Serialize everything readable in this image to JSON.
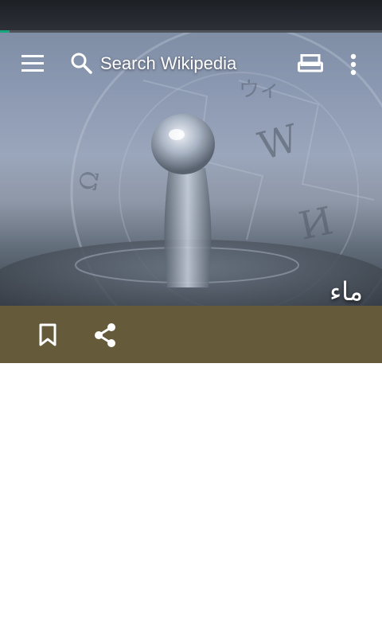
{
  "status_bar": {},
  "page_load_progress": 0.025,
  "toolbar": {
    "menu_icon": "hamburger-menu-icon",
    "search_icon": "search-icon",
    "search_placeholder": "Search Wikipedia",
    "tabs_icon": "tabs-icon",
    "more_icon": "more-vert-icon"
  },
  "lead": {
    "title": "ماء",
    "image_description_icon": "water-droplet-image"
  },
  "action_bar": {
    "bookmark_icon": "bookmark-icon",
    "share_icon": "share-icon",
    "background_color": "#655a39"
  },
  "colors": {
    "accent": "#17a57f",
    "status_bar": "#22262c"
  }
}
